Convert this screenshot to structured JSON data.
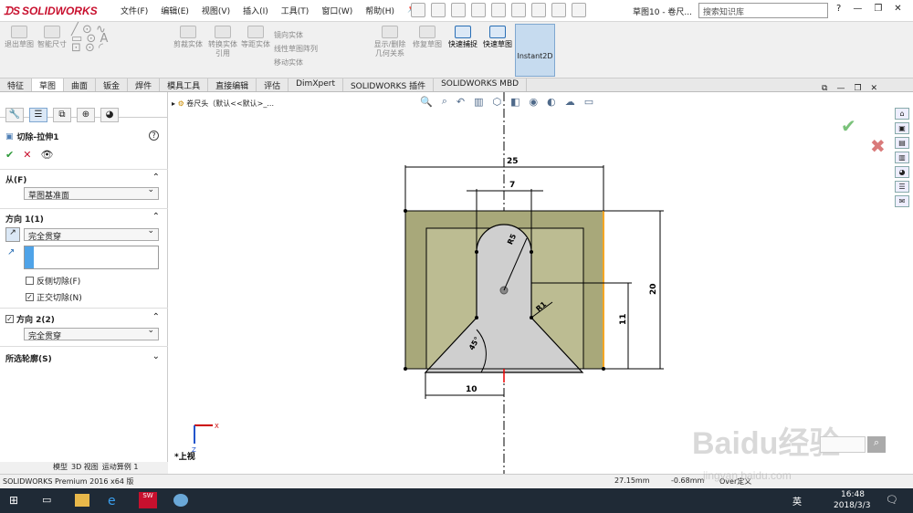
{
  "app": {
    "brand": "SOLIDWORKS",
    "doc_title": "草图10 - 卷尺..."
  },
  "menu": [
    "文件(F)",
    "编辑(E)",
    "视图(V)",
    "插入(I)",
    "工具(T)",
    "窗口(W)",
    "帮助(H)"
  ],
  "search": {
    "placeholder": "搜索知识库"
  },
  "ribbon": {
    "items": [
      "退出草图",
      "智能尺寸",
      "剪裁实体",
      "转换实体引用",
      "等距实体",
      "镜向实体",
      "线性草图阵列",
      "移动实体",
      "显示/删除几何关系",
      "修复草图",
      "快速捕捉",
      "快速草图",
      "Instant2D"
    ]
  },
  "tabs": [
    "特征",
    "草图",
    "曲面",
    "钣金",
    "焊件",
    "模具工具",
    "直接编辑",
    "评估",
    "DimXpert",
    "SOLIDWORKS 插件",
    "SOLIDWORKS MBD"
  ],
  "active_tab": "草图",
  "tree_label": "卷尺头（默认<<默认>_...",
  "panel": {
    "title": "切除-拉伸1",
    "help": "?",
    "from_label": "从(F)",
    "from_value": "草图基准面",
    "dir1_label": "方向 1(1)",
    "dir1_value": "完全贯穿",
    "flip_label": "反侧切除(F)",
    "normal_label": "正交切除(N)",
    "dir2_label": "方向 2(2)",
    "dir2_value": "完全贯穿",
    "contours_label": "所选轮廓(S)"
  },
  "drawing": {
    "dims": {
      "d25": "25",
      "d7": "7",
      "r5": "R5",
      "r1": "R1",
      "d20": "20",
      "d11": "11",
      "d10": "10",
      "a45": "45°"
    },
    "colors": {
      "plate": "#a8a87a",
      "cut": "#d0d0d0",
      "dim": "#000000",
      "highlight": "#f5a623"
    },
    "view_label": "*上视",
    "triad": {
      "x": "X",
      "z": "Z"
    }
  },
  "bottom_tabs": [
    "模型",
    "3D 视图",
    "运动算例 1"
  ],
  "status": {
    "product": "SOLIDWORKS Premium 2016 x64 版",
    "x": "27.15mm",
    "y": "-0.68mm",
    "state": "Over定义"
  },
  "taskbar": {
    "time": "16:48",
    "date": "2018/3/3",
    "ime": "英"
  },
  "watermark": {
    "text": "Baidu经验",
    "url": "jingyan.baidu.com"
  }
}
